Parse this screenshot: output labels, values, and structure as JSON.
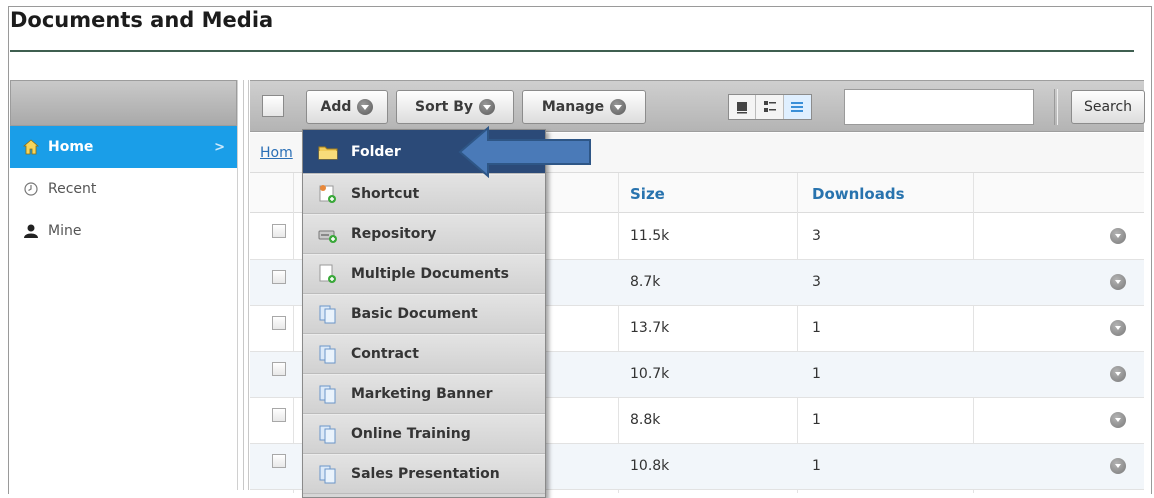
{
  "page": {
    "title": "Documents and Media"
  },
  "sidebar": {
    "items": [
      {
        "label": "Home",
        "icon": "home-icon",
        "active": true
      },
      {
        "label": "Recent",
        "icon": "clock-icon",
        "active": false
      },
      {
        "label": "Mine",
        "icon": "user-icon",
        "active": false
      }
    ]
  },
  "toolbar": {
    "add_label": "Add",
    "sort_label": "Sort By",
    "manage_label": "Manage",
    "search_value": "",
    "search_label": "Search"
  },
  "breadcrumb": {
    "label": "Hom"
  },
  "table": {
    "columns": {
      "size": "Size",
      "downloads": "Downloads"
    },
    "rows": [
      {
        "size": "11.5k",
        "downloads": "3"
      },
      {
        "size": "8.7k",
        "downloads": "3"
      },
      {
        "size": "13.7k",
        "downloads": "1"
      },
      {
        "size": "10.7k",
        "downloads": "1"
      },
      {
        "size": "8.8k",
        "downloads": "1"
      },
      {
        "size": "10.8k",
        "downloads": "1"
      }
    ]
  },
  "add_menu": {
    "items": [
      {
        "label": "Folder",
        "icon": "folder-icon",
        "highlighted": true
      },
      {
        "label": "Shortcut",
        "icon": "shortcut-icon"
      },
      {
        "label": "Repository",
        "icon": "repository-icon"
      },
      {
        "label": "Multiple Documents",
        "icon": "multiple-documents-icon"
      },
      {
        "label": "Basic Document",
        "icon": "document-icon"
      },
      {
        "label": "Contract",
        "icon": "document-icon"
      },
      {
        "label": "Marketing Banner",
        "icon": "document-icon"
      },
      {
        "label": "Online Training",
        "icon": "document-icon"
      },
      {
        "label": "Sales Presentation",
        "icon": "document-icon"
      }
    ]
  },
  "colors": {
    "accent": "#1a9ee8",
    "menu_highlight": "#2b4a78",
    "pointer_arrow": "#4a7ab8",
    "link": "#2873ae"
  }
}
